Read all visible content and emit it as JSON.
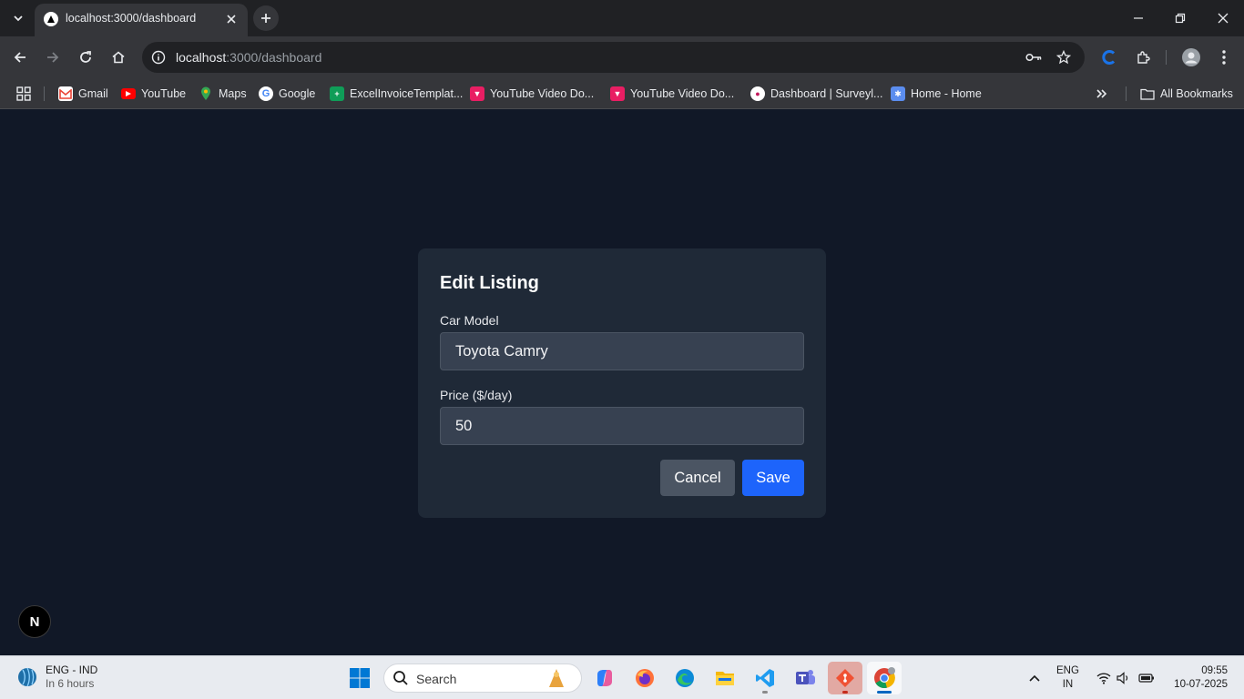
{
  "browser": {
    "tab_title": "localhost:3000/dashboard",
    "url_host": "localhost",
    "url_path": ":3000/dashboard",
    "bookmarks": [
      {
        "label": "Gmail",
        "icon": "gmail-icon",
        "color": "#ea4335"
      },
      {
        "label": "YouTube",
        "icon": "youtube-icon",
        "color": "#ff0000"
      },
      {
        "label": "Maps",
        "icon": "maps-icon",
        "color": "#34a853"
      },
      {
        "label": "Google",
        "icon": "google-icon",
        "color": "#4285f4"
      },
      {
        "label": "ExcelInvoiceTemplat...",
        "icon": "sheets-icon",
        "color": "#0f9d58"
      },
      {
        "label": "YouTube Video Do...",
        "icon": "video-downloader-icon",
        "color": "#e91e63"
      },
      {
        "label": "YouTube Video Do...",
        "icon": "video-downloader-icon",
        "color": "#e91e63"
      },
      {
        "label": "Dashboard | Surveyl...",
        "icon": "surveylegend-icon",
        "color": "#c2185b"
      },
      {
        "label": "Home - Home",
        "icon": "asterisk-icon",
        "color": "#5b8def"
      }
    ],
    "all_bookmarks_label": "All Bookmarks"
  },
  "dialog": {
    "title": "Edit Listing",
    "car_model_label": "Car Model",
    "car_model_value": "Toyota Camry",
    "price_label": "Price ($/day)",
    "price_value": "50",
    "cancel_label": "Cancel",
    "save_label": "Save"
  },
  "next_badge": "N",
  "taskbar": {
    "weather_line1": "ENG - IND",
    "weather_line2": "In 6 hours",
    "search_placeholder": "Search",
    "lang_line1": "ENG",
    "lang_line2": "IN",
    "time": "09:55",
    "date": "10-07-2025"
  },
  "colors": {
    "page_bg": "#111827",
    "dialog_bg": "#1f2937",
    "input_bg": "#374151",
    "cancel_bg": "#4b5563",
    "save_bg": "#1d64fb"
  }
}
